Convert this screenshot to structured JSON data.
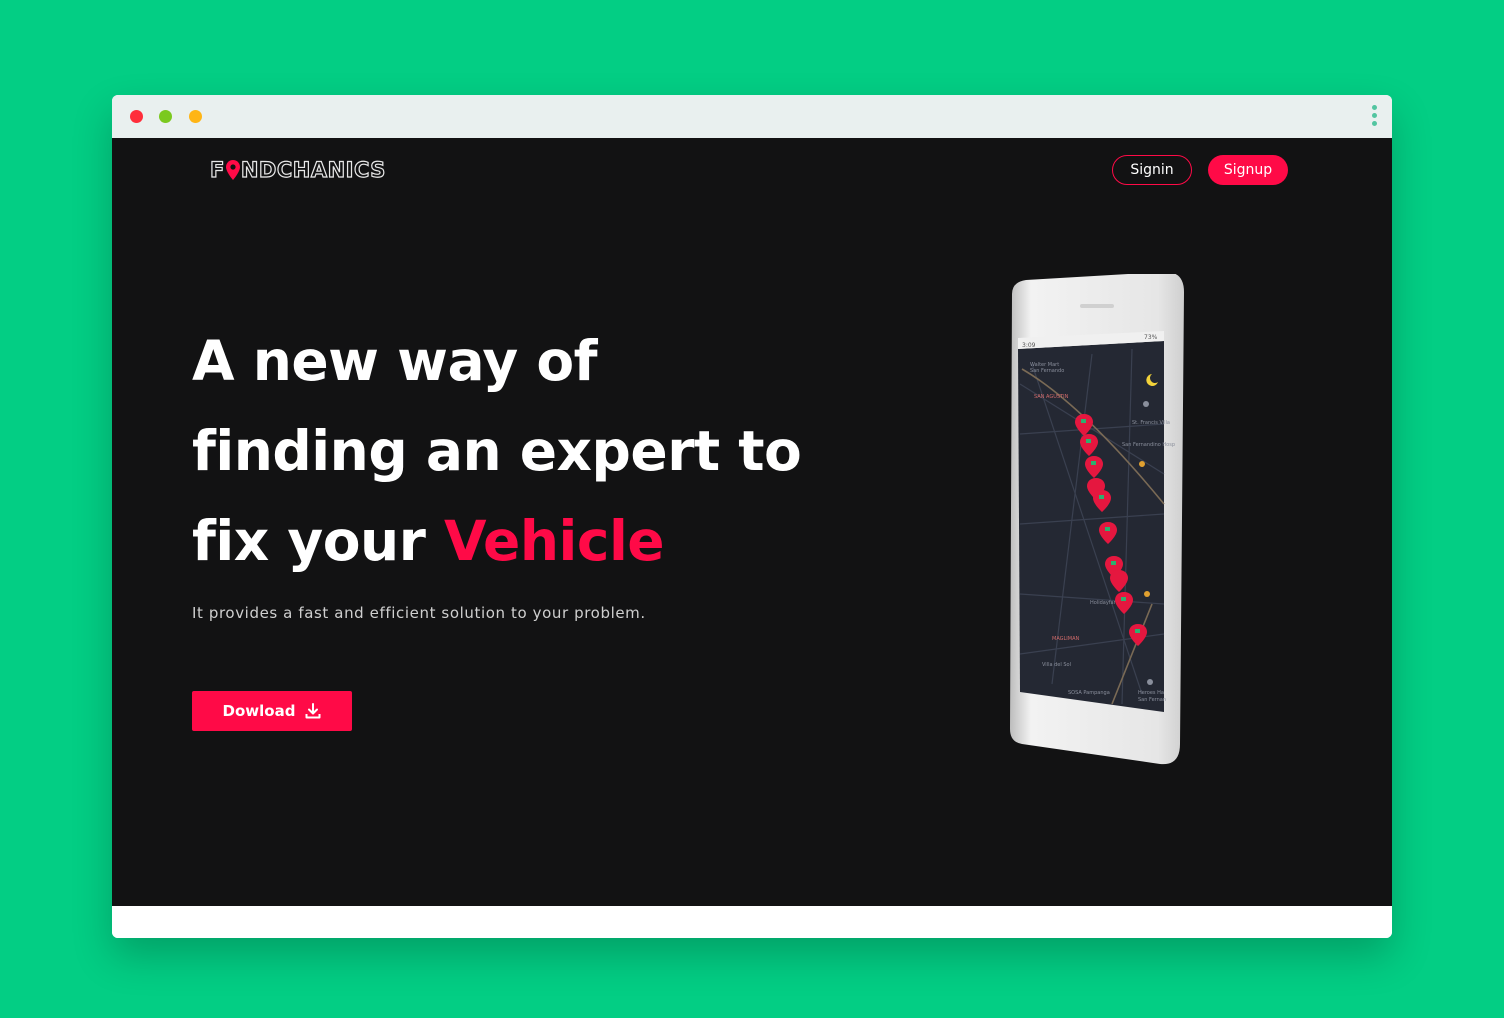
{
  "window": {
    "controls": [
      "close",
      "minimize",
      "maximize"
    ],
    "menu_icon": "kebab-menu-icon"
  },
  "header": {
    "logo_text": "FINDCHANICS",
    "signin_label": "Signin",
    "signup_label": "Signup"
  },
  "hero": {
    "title_line1": "A new way of",
    "title_line2": "finding an expert to",
    "title_line3_prefix": "fix your",
    "title_accent": "Vehicle",
    "subtitle": "It provides a fast and efficient solution to your problem.",
    "download_label": "Dowload",
    "download_icon": "download-icon"
  },
  "phone": {
    "status_time": "3:09",
    "battery": "73%",
    "map_labels": [
      "Walter Mart San Fernando",
      "SAN AGUSTIN",
      "St. Francis Villa",
      "San Fernandino Hosp",
      "Holidayfarm",
      "MAGLIMAN",
      "Villa del Sol",
      "SOSA Pampanga",
      "Heroes Ha San Fernan"
    ]
  },
  "colors": {
    "background": "#03CE84",
    "accent": "#FF0A47",
    "page_bg": "#121213"
  }
}
